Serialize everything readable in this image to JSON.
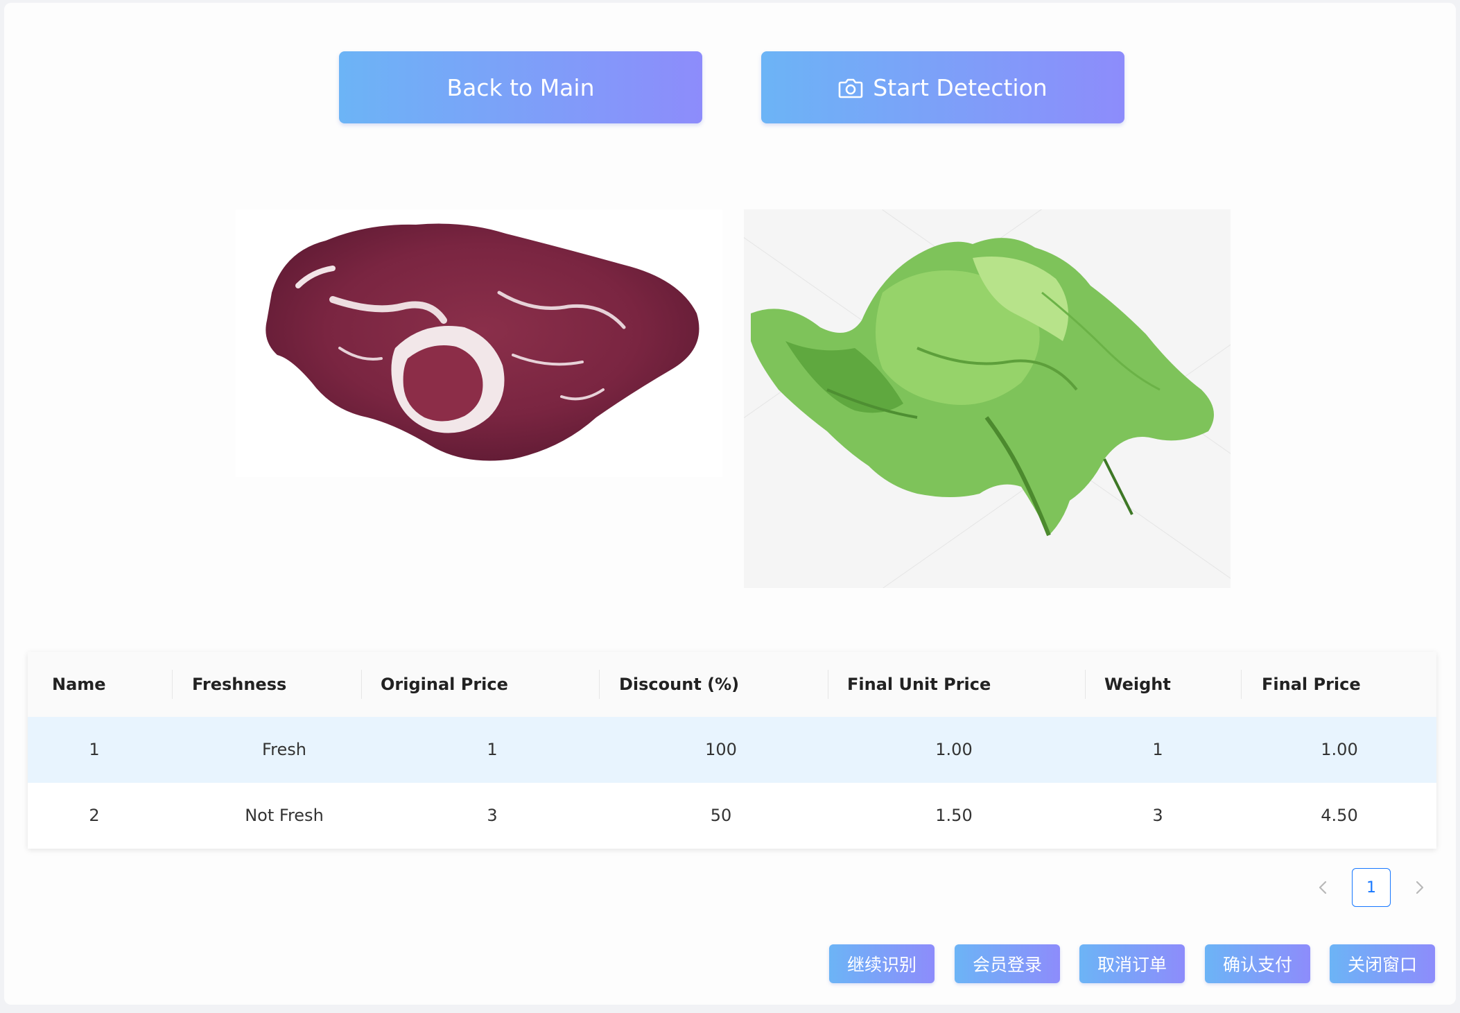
{
  "toolbar": {
    "back_label": "Back to Main",
    "detect_label": "Start Detection",
    "detect_icon": "camera-icon"
  },
  "images": [
    {
      "subject": "raw beef steak"
    },
    {
      "subject": "green lettuce"
    }
  ],
  "table": {
    "headers": [
      "Name",
      "Freshness",
      "Original Price",
      "Discount (%)",
      "Final Unit Price",
      "Weight",
      "Final Price"
    ],
    "rows": [
      {
        "name": "1",
        "freshness": "Fresh",
        "original_price": "1",
        "discount": "100",
        "final_unit_price": "1.00",
        "weight": "1",
        "final_price": "1.00"
      },
      {
        "name": "2",
        "freshness": "Not Fresh",
        "original_price": "3",
        "discount": "50",
        "final_unit_price": "1.50",
        "weight": "3",
        "final_price": "4.50"
      }
    ]
  },
  "pagination": {
    "current_page": "1",
    "prev_icon": "chevron-left-icon",
    "next_icon": "chevron-right-icon"
  },
  "actions": {
    "continue_label": "继续识别",
    "member_label": "会员登录",
    "cancel_label": "取消订单",
    "pay_label": "确认支付",
    "close_label": "关闭窗口"
  },
  "colors": {
    "accent_start": "#6cb4f6",
    "accent_end": "#8d8cfb",
    "row_highlight": "#e8f4fe",
    "pager_active": "#1677ff"
  }
}
